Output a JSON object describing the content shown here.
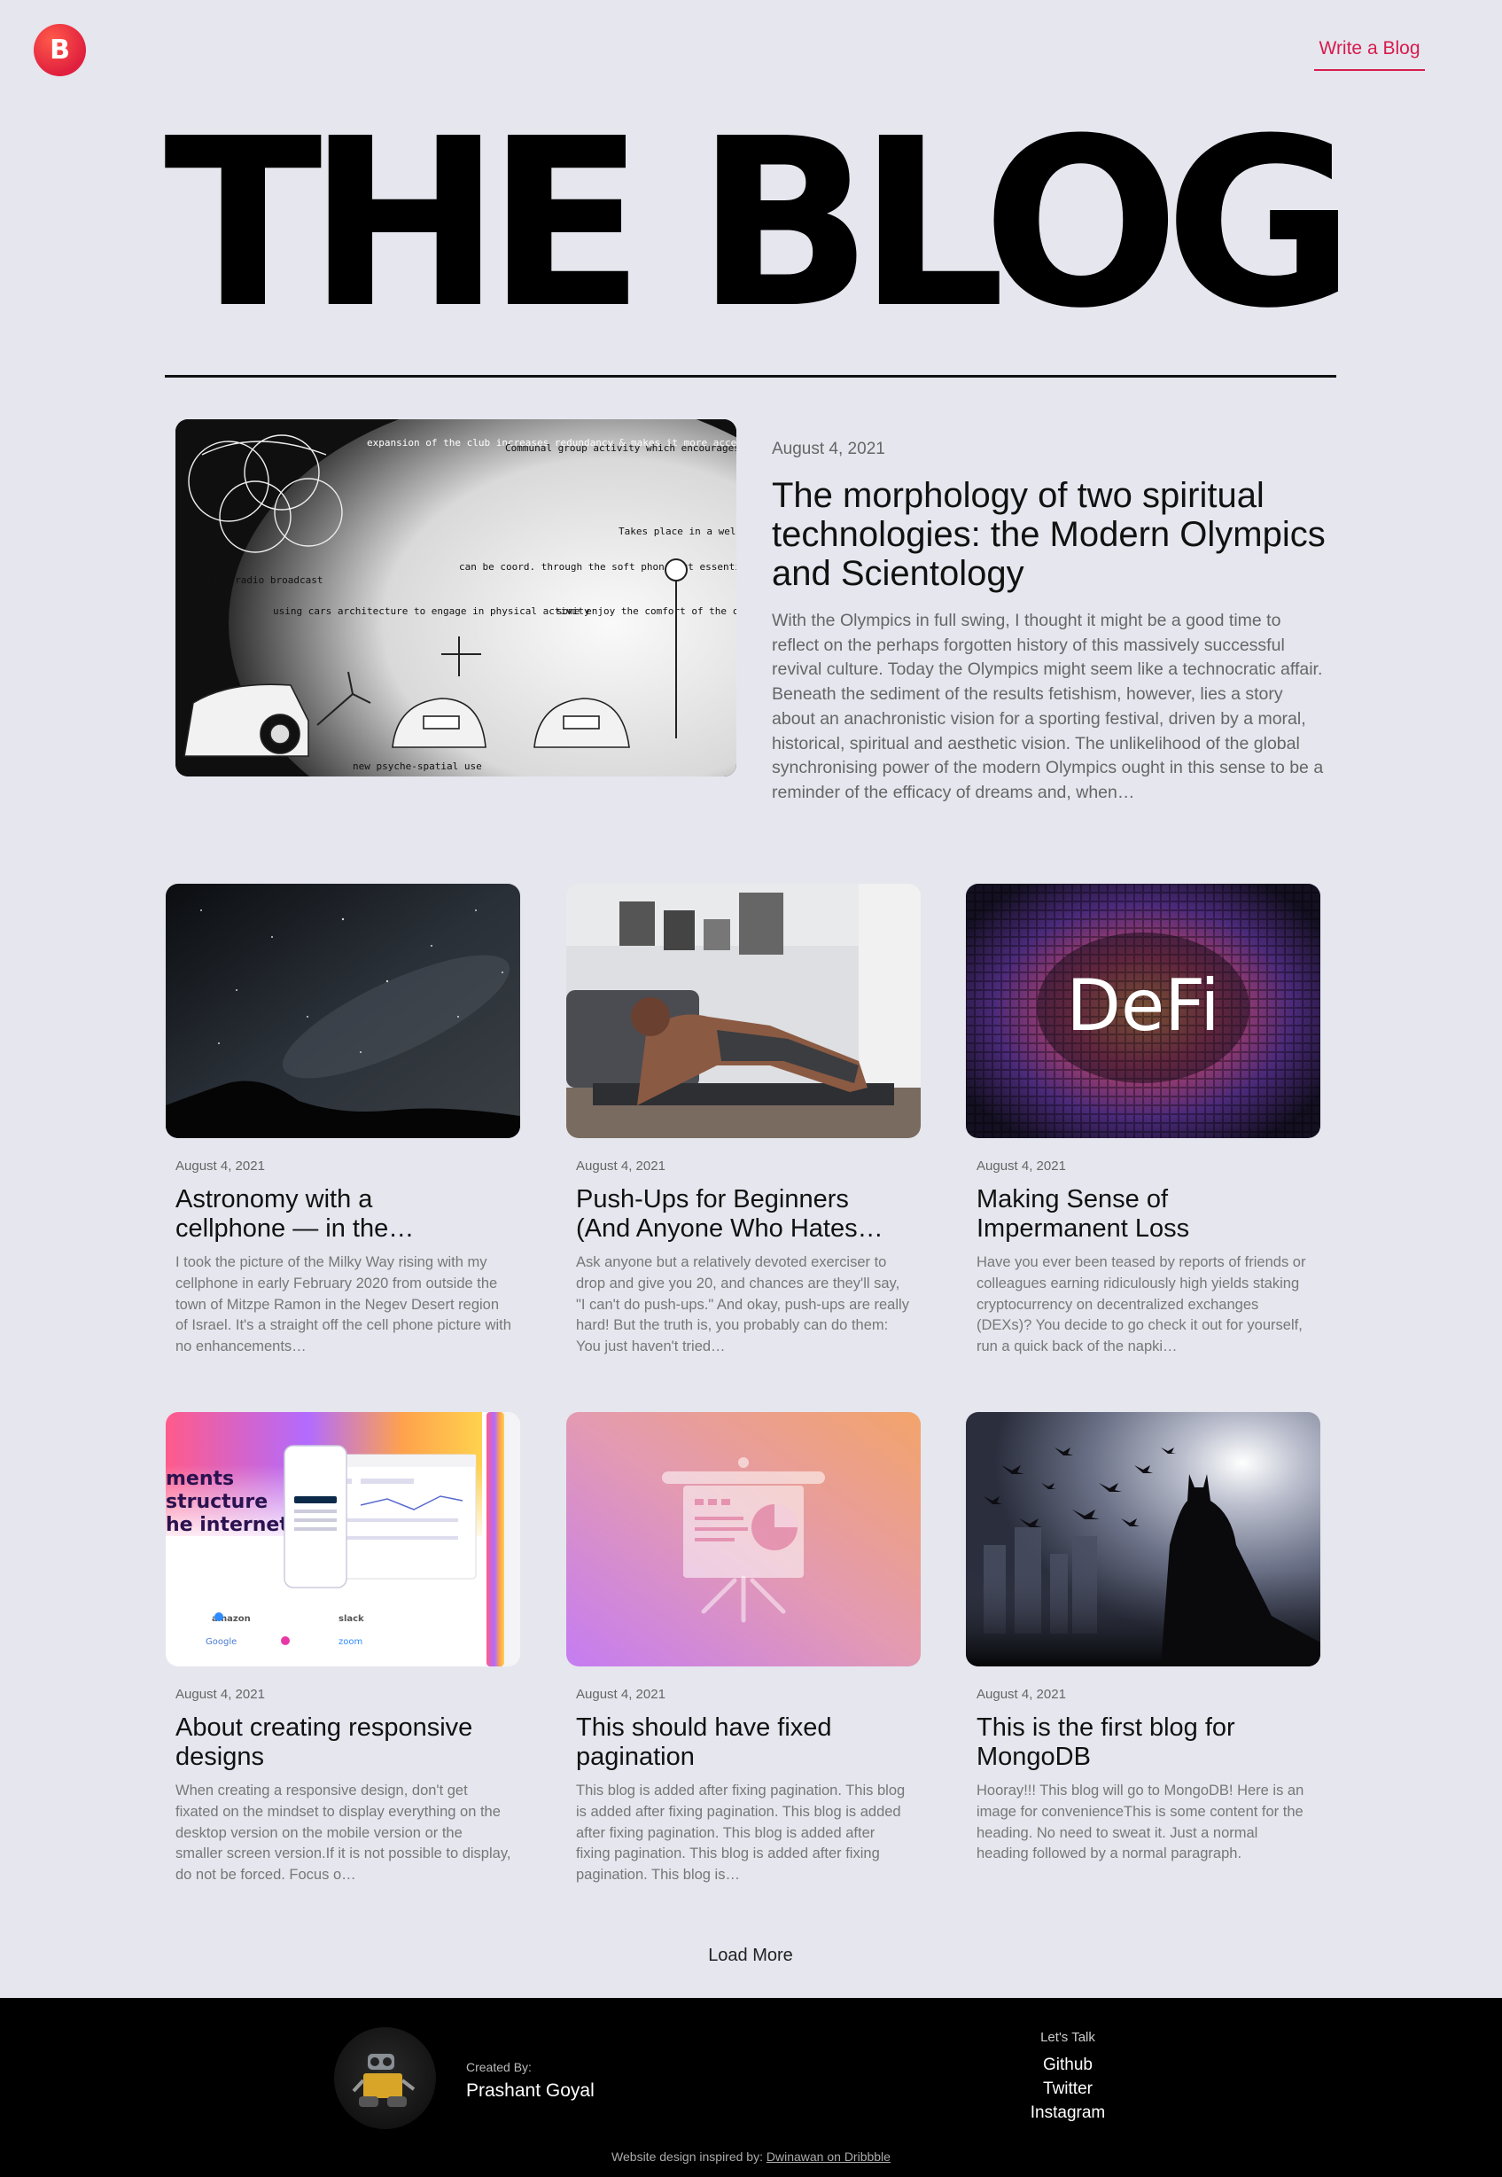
{
  "header": {
    "logo_letter": "B",
    "write_link": "Write a Blog"
  },
  "hero": {
    "title": "THE BLOG"
  },
  "featured": {
    "date": "August 4, 2021",
    "title": "The morphology of two spiritual technologies: the Modern Olympics and Scientology",
    "excerpt": "With the Olympics in full swing, I thought it might be a good time to reflect on the perhaps forgotten history of this massively successful revival culture. Today the Olympics might seem like a technocratic affair. Beneath the sediment of the results fetishism, however, lies a story about an anachronistic vision for a sporting festival, driven by a moral, historical, spiritual and aesthetic vision. The unlikelihood of the global synchronising power of the modern Olympics ought in this sense to be a reminder of the efficacy of dreams and, when…",
    "image_text": {
      "n1": "expansion of the club increases redundancy & makes it more accessible.",
      "n2": "Communal group activity which encourages social connection & leads to improved mental health.",
      "n3": "Takes place in a well lit area.",
      "n4": "live radio broadcast",
      "n5": "using cars architecture to engage in physical activity",
      "n6": "can be coord. through the soft phone but essential nature of the carl",
      "n7": "some enjoy the comfort of the car's techno-cocoon",
      "n8": "new psyche-spatial use"
    }
  },
  "posts": [
    {
      "date": "August 4, 2021",
      "title": "Astronomy with a\ncellphone — in the…",
      "excerpt": "I took the picture of the Milky Way rising with my cellphone in early February 2020 from outside the town of Mitzpe Ramon in the Negev Desert region of Israel. It's a straight off the cell phone picture with no enhancements…"
    },
    {
      "date": "August 4, 2021",
      "title": "Push-Ups for Beginners\n(And Anyone Who Hates…",
      "excerpt": "Ask anyone but a relatively devoted exerciser to drop and give you 20, and chances are they'll say, \"I can't do push-ups.\" And okay, push-ups are really hard! But the truth is, you probably can do them: You just haven't tried…"
    },
    {
      "date": "August 4, 2021",
      "title": "Making Sense of\nImpermanent Loss",
      "excerpt": "Have you ever been teased by reports of friends or colleagues earning ridiculously high yields staking cryptocurrency on decentralized exchanges (DEXs)? You decide to go check it out for yourself, run a quick back of the napki…",
      "image_text": "DeFi"
    },
    {
      "date": "August 4, 2021",
      "title": "About creating responsive\ndesigns",
      "excerpt": "When creating a responsive design, don't get fixated on the mindset to display everything on the desktop version on the mobile version or the smaller screen version.If it is not possible to display, do not be forced. Focus o…",
      "image_text": {
        "headline1": "ments",
        "headline2": "structure",
        "headline3": "he internet",
        "logo_amazon": "amazon",
        "logo_slack": "slack",
        "logo_google": "Google",
        "logo_zoom": "zoom"
      }
    },
    {
      "date": "August 4, 2021",
      "title": "This should have fixed\npagination",
      "excerpt": "This blog is added after fixing pagination. This blog is added after fixing pagination. This blog is added after fixing pagination. This blog is added after fixing pagination. This blog is added after fixing pagination. This blog is…"
    },
    {
      "date": "August 4, 2021",
      "title": "This is the first blog for\nMongoDB",
      "excerpt": "Hooray!!! This blog will go to MongoDB! Here is an image for convenienceThis is some content for the heading. No need to sweat it. Just a normal heading followed by a normal paragraph."
    }
  ],
  "load_more": "Load More",
  "footer": {
    "created_by_label": "Created By:",
    "author": "Prashant Goyal",
    "lets_talk": "Let's Talk",
    "links": [
      "Github",
      "Twitter",
      "Instagram"
    ],
    "credits_prefix": "Website design inspired by:",
    "credits_link": "Dwinawan on Dribbble"
  },
  "colors": {
    "accent": "#d81b4c",
    "background": "#e5e6ee",
    "footer": "#000000"
  }
}
